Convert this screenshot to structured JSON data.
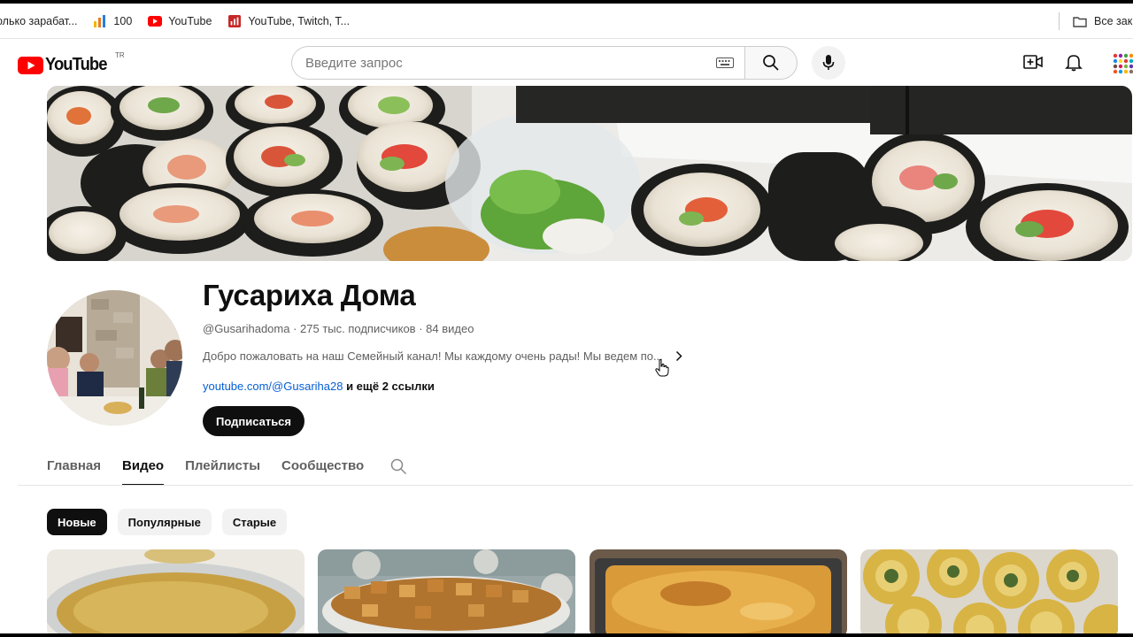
{
  "bookmarks": {
    "items": [
      {
        "label": "олько зарабат...",
        "icon": "bookmark-page-icon"
      },
      {
        "label": "100",
        "icon": "bar-chart-icon"
      },
      {
        "label": "YouTube",
        "icon": "youtube-icon"
      },
      {
        "label": "YouTube, Twitch, T...",
        "icon": "stats-icon"
      }
    ],
    "all_bookmarks": "Все зак"
  },
  "masthead": {
    "logo": "YouTube",
    "country_code": "TR",
    "search_placeholder": "Введите запрос"
  },
  "channel": {
    "name": "Гусариха Дома",
    "handle": "@Gusarihadoma",
    "subscribers": "275 тыс. подписчиков",
    "videos": "84 видео",
    "meta_separator": " · ",
    "description": "Добро пожаловать на наш Семейный канал! Мы каждому очень рады! Мы ведем по...",
    "link": "youtube.com/@Gusariha28",
    "more_links": " и ещё 2 ссылки",
    "subscribe_label": "Подписаться"
  },
  "tabs": [
    {
      "label": "Главная",
      "active": false
    },
    {
      "label": "Видео",
      "active": true
    },
    {
      "label": "Плейлисты",
      "active": false
    },
    {
      "label": "Сообщество",
      "active": false
    }
  ],
  "chips": [
    {
      "label": "Новые",
      "active": true
    },
    {
      "label": "Популярные",
      "active": false
    },
    {
      "label": "Старые",
      "active": false
    }
  ],
  "colors": {
    "youtube_red": "#ff0000",
    "link_blue": "#065fd4",
    "text_primary": "#0f0f0f",
    "text_secondary": "#606060"
  }
}
